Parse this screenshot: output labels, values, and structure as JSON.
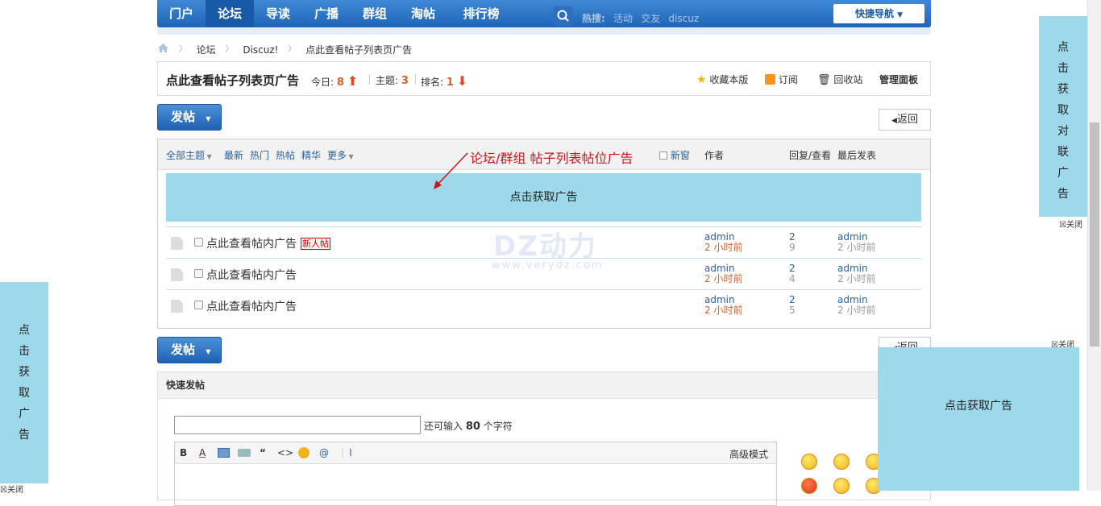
{
  "nav": {
    "items": [
      "门户",
      "论坛",
      "导读",
      "广播",
      "群组",
      "淘帖",
      "排行榜"
    ],
    "active_index": 1,
    "quick_nav_label": "快捷导航",
    "search_hot_label": "热搜:",
    "search_hot_words": [
      "活动",
      "交友",
      "discuz"
    ]
  },
  "breadcrumb": [
    "论坛",
    "Discuz!",
    "点此查看帖子列表页广告"
  ],
  "forum": {
    "title": "点此查看帖子列表页广告",
    "today_label": "今日:",
    "today_value": "8",
    "threads_label": "主题:",
    "threads_value": "3",
    "rank_label": "排名:",
    "rank_value": "1",
    "links": [
      "收藏本版",
      "订阅",
      "回收站",
      "管理面板"
    ]
  },
  "buttons": {
    "post": "发帖",
    "back": "返回"
  },
  "filters": [
    "全部主题",
    "最新",
    "热门",
    "热帖",
    "精华",
    "更多"
  ],
  "columns": {
    "new_window": "新窗",
    "author": "作者",
    "reply_view": "回复/查看",
    "last_post": "最后发表"
  },
  "annotation": "论坛/群组 帖子列表帖位广告",
  "list_ad_text": "点击获取广告",
  "watermark": {
    "title": "DZ动力",
    "url": "www.verydz.com"
  },
  "threads": [
    {
      "title": "点此查看帖内广告",
      "badge": "新人帖",
      "author": "admin",
      "time": "2 小时前",
      "replies": "2",
      "views": "9",
      "last_author": "admin",
      "last_time": "2 小时前"
    },
    {
      "title": "点此查看帖内广告",
      "badge": "",
      "author": "admin",
      "time": "2 小时前",
      "replies": "2",
      "views": "4",
      "last_author": "admin",
      "last_time": "2 小时前"
    },
    {
      "title": "点此查看帖内广告",
      "badge": "",
      "author": "admin",
      "time": "2 小时前",
      "replies": "2",
      "views": "5",
      "last_author": "admin",
      "last_time": "2 小时前"
    }
  ],
  "quick_post": {
    "header": "快速发帖",
    "remaining_prefix": "还可输入",
    "remaining_value": "80",
    "remaining_suffix": "个字符",
    "advanced_mode": "高级模式"
  },
  "side_ads": {
    "right_top_chars": [
      "点",
      "击",
      "获",
      "取",
      "对",
      "联",
      "广",
      "告"
    ],
    "left_chars": [
      "点",
      "击",
      "获",
      "取",
      "广",
      "告"
    ],
    "bottom_right_text": "点击获取广告",
    "close_label": "关闭"
  },
  "colors": {
    "nav_blue": "#1f65b7",
    "ad_bg": "#9dd9ea",
    "accent_red": "#d0121b",
    "time_orange": "#e05c20",
    "link_blue": "#2b5f9e"
  }
}
